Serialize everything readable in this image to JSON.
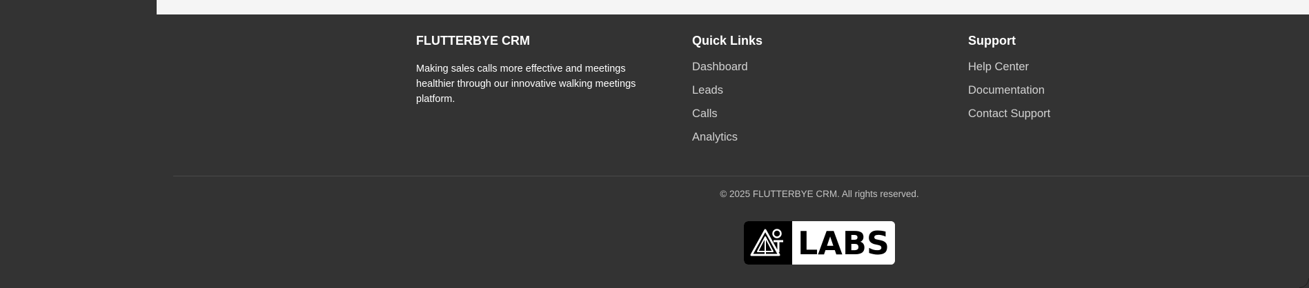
{
  "brand": {
    "title": "FLUTTERBYE CRM",
    "description": "Making sales calls more effective and meetings healthier through our innovative walking meetings platform."
  },
  "quick_links": {
    "title": "Quick Links",
    "items": [
      {
        "label": "Dashboard"
      },
      {
        "label": "Leads"
      },
      {
        "label": "Calls"
      },
      {
        "label": "Analytics"
      }
    ]
  },
  "support": {
    "title": "Support",
    "items": [
      {
        "label": "Help Center"
      },
      {
        "label": "Documentation"
      },
      {
        "label": "Contact Support"
      }
    ]
  },
  "copyright": "© 2025 FLUTTERBYE CRM. All rights reserved.",
  "labs_logo": {
    "word": "LABS",
    "mark_icon": "labs-triangle-icon"
  },
  "colors": {
    "footer_bg": "#333333",
    "content_bg": "#f5f5f5",
    "heading": "#ffffff",
    "link": "#d2d2d2",
    "muted": "#c4c4c4"
  }
}
